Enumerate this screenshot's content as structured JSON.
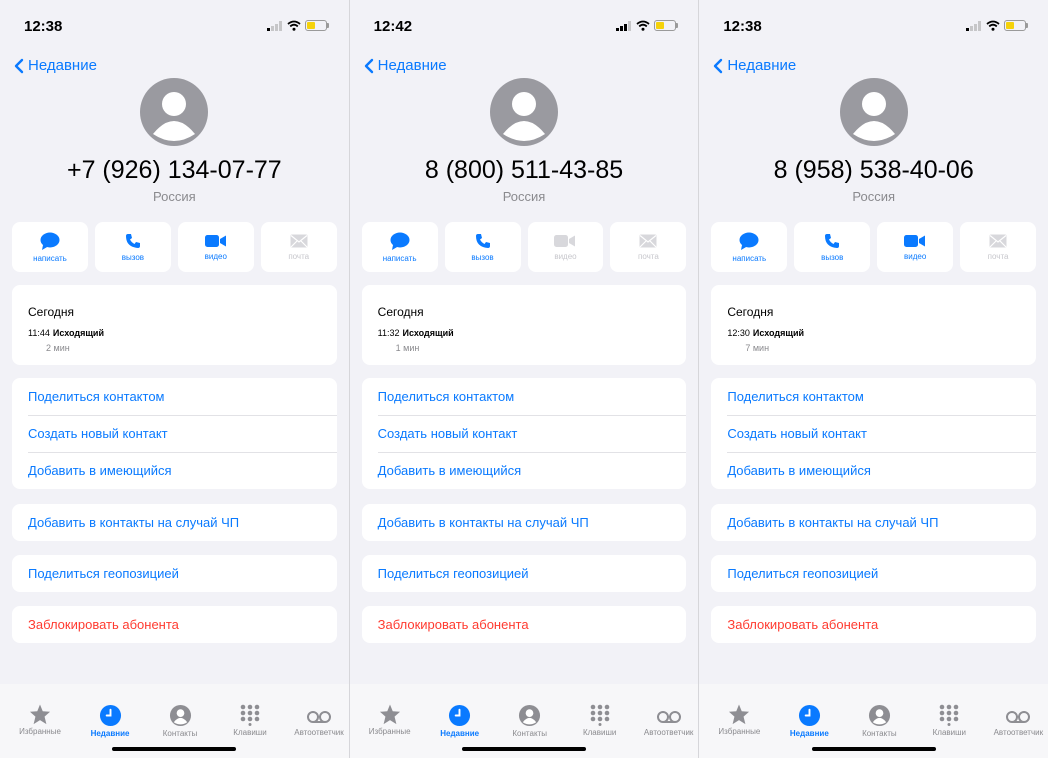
{
  "colors": {
    "accent": "#0a7aff",
    "destructive": "#ff3b30",
    "disabled": "#c7c7cc",
    "background": "#f2f2f7"
  },
  "screens": [
    {
      "status": {
        "time": "12:38"
      },
      "nav": {
        "back_label": "Недавние"
      },
      "contact": {
        "number": "+7 (926) 134-07-77",
        "country": "Россия"
      },
      "actions": [
        {
          "label": "написать",
          "icon": "message-bubble-icon",
          "enabled": true
        },
        {
          "label": "вызов",
          "icon": "phone-icon",
          "enabled": true
        },
        {
          "label": "видео",
          "icon": "video-camera-icon",
          "enabled": true
        },
        {
          "label": "почта",
          "icon": "mail-envelope-icon",
          "enabled": false
        }
      ],
      "recent": {
        "day": "Сегодня",
        "time": "11:44",
        "type": "Исходящий",
        "duration": "2 мин"
      }
    },
    {
      "status": {
        "time": "12:42"
      },
      "nav": {
        "back_label": "Недавние"
      },
      "contact": {
        "number": "8 (800) 511-43-85",
        "country": "Россия"
      },
      "actions": [
        {
          "label": "написать",
          "icon": "message-bubble-icon",
          "enabled": true
        },
        {
          "label": "вызов",
          "icon": "phone-icon",
          "enabled": true
        },
        {
          "label": "видео",
          "icon": "video-camera-icon",
          "enabled": false
        },
        {
          "label": "почта",
          "icon": "mail-envelope-icon",
          "enabled": false
        }
      ],
      "recent": {
        "day": "Сегодня",
        "time": "11:32",
        "type": "Исходящий",
        "duration": "1 мин"
      }
    },
    {
      "status": {
        "time": "12:38"
      },
      "nav": {
        "back_label": "Недавние"
      },
      "contact": {
        "number": "8 (958) 538-40-06",
        "country": "Россия"
      },
      "actions": [
        {
          "label": "написать",
          "icon": "message-bubble-icon",
          "enabled": true
        },
        {
          "label": "вызов",
          "icon": "phone-icon",
          "enabled": true
        },
        {
          "label": "видео",
          "icon": "video-camera-icon",
          "enabled": true
        },
        {
          "label": "почта",
          "icon": "mail-envelope-icon",
          "enabled": false
        }
      ],
      "recent": {
        "day": "Сегодня",
        "time": "12:30",
        "type": "Исходящий",
        "duration": "7 мин"
      }
    }
  ],
  "menu": {
    "share_contact": "Поделиться контактом",
    "create_contact": "Создать новый контакт",
    "add_existing": "Добавить в имеющийся",
    "add_emergency": "Добавить в контакты на случай ЧП",
    "share_location": "Поделиться геопозицией",
    "block_caller": "Заблокировать абонента"
  },
  "tabbar": {
    "active": "Недавние",
    "items": [
      {
        "label": "Избранные",
        "icon": "star-icon"
      },
      {
        "label": "Недавние",
        "icon": "clock-icon"
      },
      {
        "label": "Контакты",
        "icon": "person-circle-icon"
      },
      {
        "label": "Клавиши",
        "icon": "keypad-icon"
      },
      {
        "label": "Автоответчик",
        "icon": "voicemail-icon"
      }
    ]
  }
}
